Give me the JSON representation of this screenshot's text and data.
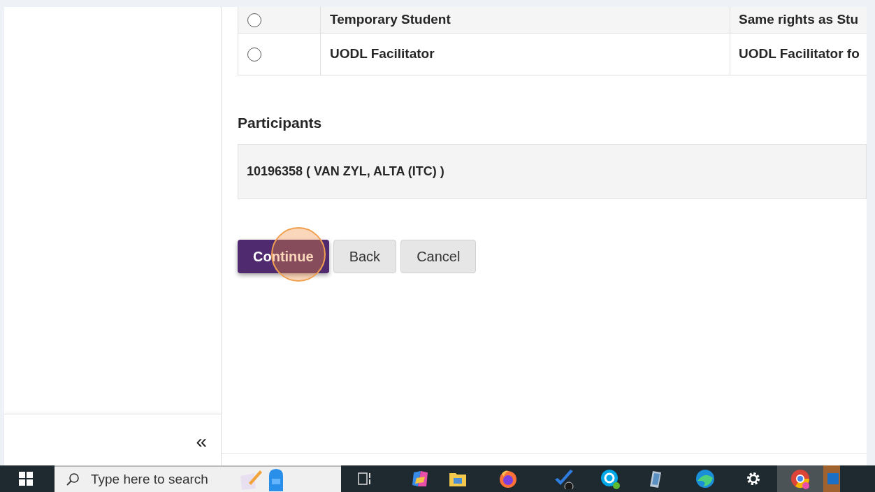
{
  "roles": [
    {
      "name": "Temporary Student",
      "description": "Same rights as Stu",
      "selected": false
    },
    {
      "name": "UODL Facilitator",
      "description": "UODL Facilitator fo",
      "selected": false
    }
  ],
  "participants": {
    "heading": "Participants",
    "items": [
      "10196358 ( VAN ZYL, ALTA (ITC) )"
    ]
  },
  "buttons": [
    {
      "label": "Continue",
      "kind": "primary"
    },
    {
      "label": "Back",
      "kind": "secondary"
    },
    {
      "label": "Cancel",
      "kind": "secondary"
    }
  ],
  "sidebar": {
    "collapse_label": "«"
  },
  "taskbar": {
    "search_placeholder": "Type here to search"
  }
}
